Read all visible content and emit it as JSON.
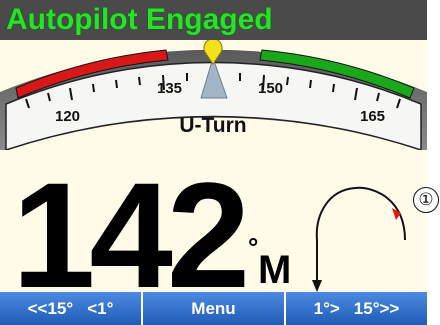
{
  "status": {
    "text": "Autopilot Engaged"
  },
  "compass": {
    "scale_labels": [
      "120",
      "135",
      "150",
      "165"
    ],
    "mode": "U-Turn"
  },
  "heading": {
    "value": "142",
    "degree": "°",
    "reference": "M"
  },
  "callout": {
    "number": "①"
  },
  "softkeys": {
    "left_a": "<<15°",
    "left_b": "<1°",
    "menu": "Menu",
    "right_a": "1°>",
    "right_b": "15°>>"
  },
  "colors": {
    "status_text": "#22e622",
    "port_arc": "#d81818",
    "starboard_arc": "#1aa81a",
    "softkey_bar": "#2f6fc8",
    "pointer": "#f2e21a"
  }
}
